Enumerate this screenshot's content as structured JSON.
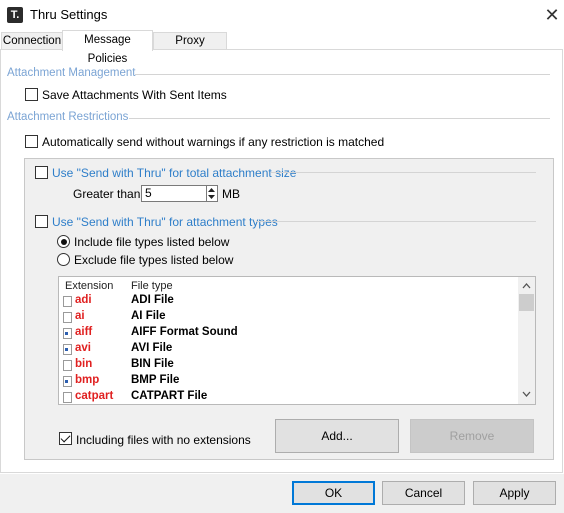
{
  "window": {
    "app_icon_glyph": "T.",
    "title": "Thru Settings",
    "close_glyph": "✕"
  },
  "tabs": [
    {
      "label": "Connection"
    },
    {
      "label": "Message Policies"
    },
    {
      "label": "Proxy Settings"
    }
  ],
  "attachment_management": {
    "heading": "Attachment Management",
    "save_attachments_label": "Save Attachments With Sent Items",
    "save_attachments_checked": false
  },
  "attachment_restrictions": {
    "heading": "Attachment Restrictions",
    "auto_send_label": "Automatically send without warnings if any restriction is matched",
    "auto_send_checked": false
  },
  "size_group": {
    "label": "Use \"Send with Thru\" for total attachment size",
    "checked": false,
    "greater_than_label": "Greater than:",
    "greater_than_value": "5",
    "unit": "MB"
  },
  "types_group": {
    "label": "Use \"Send with Thru\" for attachment types",
    "checked": false,
    "include_label": "Include file types listed below",
    "exclude_label": "Exclude file types listed below",
    "selected_mode": "include",
    "columns": {
      "extension": "Extension",
      "file_type": "File type"
    },
    "rows": [
      {
        "ext": "adi",
        "type": "ADI File",
        "icon": "document-icon"
      },
      {
        "ext": "ai",
        "type": "AI File",
        "icon": "document-icon"
      },
      {
        "ext": "aiff",
        "type": "AIFF Format Sound",
        "icon": "media-file-icon"
      },
      {
        "ext": "avi",
        "type": "AVI File",
        "icon": "media-file-icon"
      },
      {
        "ext": "bin",
        "type": "BIN File",
        "icon": "document-icon"
      },
      {
        "ext": "bmp",
        "type": "BMP File",
        "icon": "media-file-icon"
      },
      {
        "ext": "catpart",
        "type": "CATPART File",
        "icon": "document-icon"
      }
    ],
    "no_ext_label": "Including files with no extensions",
    "no_ext_checked": true,
    "add_button": "Add...",
    "remove_button": "Remove"
  },
  "footer": {
    "ok": "OK",
    "cancel": "Cancel",
    "apply": "Apply"
  },
  "colors": {
    "section_heading": "#7ba4d4",
    "link_blue": "#2e7ec9",
    "extension_red": "#e02020",
    "focus_blue": "#0078d7"
  }
}
